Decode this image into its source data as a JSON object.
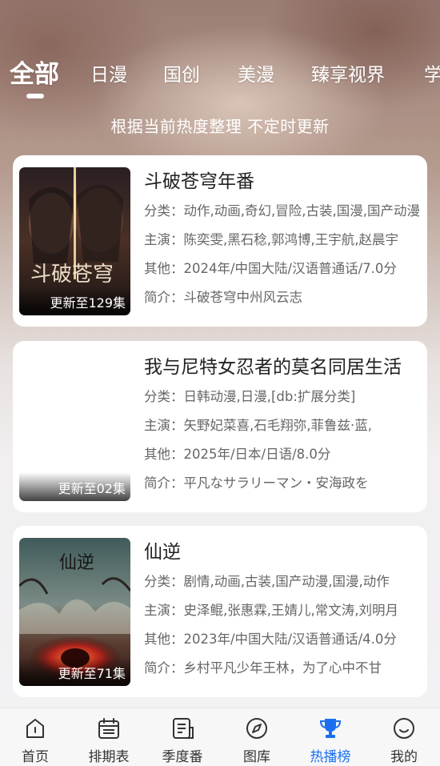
{
  "tabs": [
    {
      "label": "全部",
      "active": true
    },
    {
      "label": "日漫",
      "active": false
    },
    {
      "label": "国创",
      "active": false
    },
    {
      "label": "美漫",
      "active": false
    },
    {
      "label": "臻享视界",
      "active": false
    },
    {
      "label": "学",
      "active": false
    }
  ],
  "subtitle": "根据当前热度整理 不定时更新",
  "cards": [
    {
      "title": "斗破苍穹年番",
      "badge": "更新至129集",
      "genre": "分类：动作,动画,奇幻,冒险,古装,国漫,国产动漫",
      "cast": "主演：陈奕雯,黑石稔,郭鸿博,王宇航,赵晨宇",
      "other": "其他：2024年/中国大陆/汉语普通话/7.0分",
      "intro": "简介：斗破苍穹中州风云志",
      "cover_text": "斗破苍穹"
    },
    {
      "title": "我与尼特女忍者的莫名同居生活",
      "badge": "更新至02集",
      "genre": "分类：日韩动漫,日漫,[db:扩展分类]",
      "cast": "主演：矢野妃菜喜,石毛翔弥,菲鲁兹·蓝,",
      "other": "其他：2025年/日本/日语/8.0分",
      "intro": "简介：平凡なサラリーマン・安海政を",
      "cover_text": ""
    },
    {
      "title": "仙逆",
      "badge": "更新至71集",
      "genre": "分类：剧情,动画,古装,国产动漫,国漫,动作",
      "cast": "主演：史泽鲲,张惠霖,王婧儿,常文涛,刘明月",
      "other": "其他：2023年/中国大陆/汉语普通话/4.0分",
      "intro": "简介：乡村平凡少年王林，为了心中不甘",
      "cover_text": "仙逆"
    }
  ],
  "nav": [
    {
      "label": "首页",
      "icon": "home-icon",
      "active": false
    },
    {
      "label": "排期表",
      "icon": "calendar-icon",
      "active": false
    },
    {
      "label": "季度番",
      "icon": "document-icon",
      "active": false
    },
    {
      "label": "图库",
      "icon": "compass-icon",
      "active": false
    },
    {
      "label": "热播榜",
      "icon": "trophy-icon",
      "active": true
    },
    {
      "label": "我的",
      "icon": "smile-icon",
      "active": false
    }
  ],
  "colors": {
    "accent": "#1a6ff0",
    "nav_inactive": "#333333"
  }
}
